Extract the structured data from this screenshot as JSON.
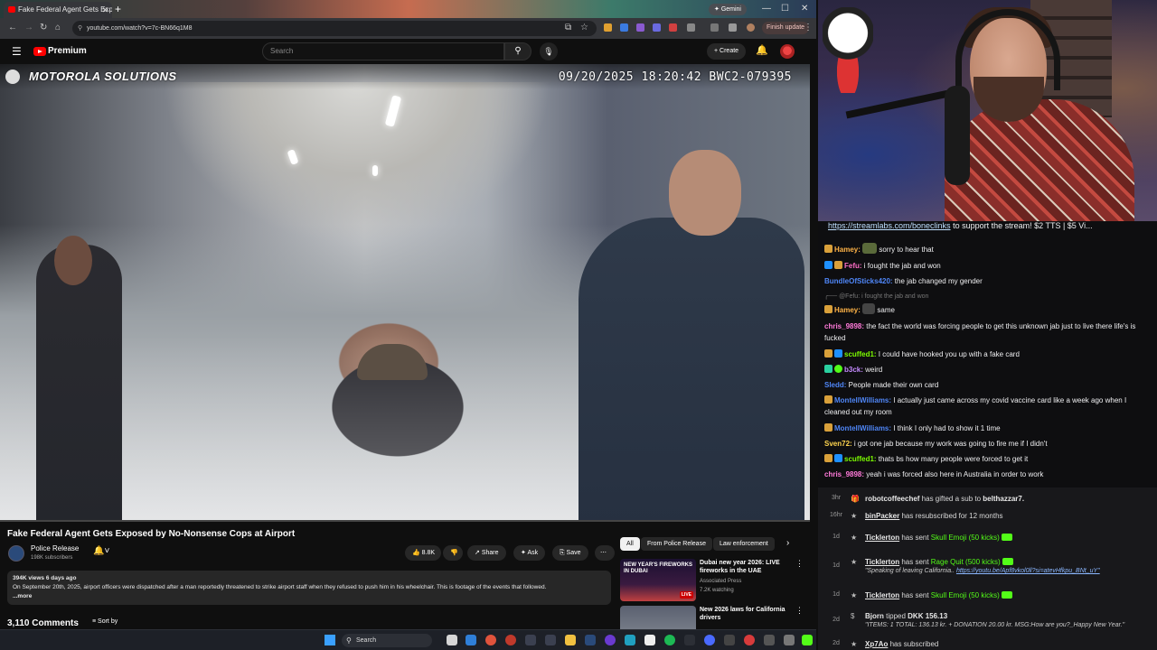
{
  "browser": {
    "tab_title": "Fake Federal Agent Gets Expos",
    "gemini_label": "Gemini",
    "url": "youtube.com/watch?v=7c-BN66q1M8",
    "finish_update_label": "Finish update"
  },
  "youtube": {
    "logo_text": "Premium",
    "search_placeholder": "Search",
    "create_label": "Create",
    "video": {
      "brand_text": "MOTOROLA SOLUTIONS",
      "timestamp": "09/20/2025 18:20:42 BWC2-079395",
      "progress": 0.0
    },
    "title": "Fake Federal Agent Gets Exposed by No-Nonsense Cops at Airport",
    "channel": {
      "name": "Police Release",
      "subs": "198K subscribers"
    },
    "actions": {
      "likes": "8.8K",
      "share": "Share",
      "ask": "Ask",
      "save": "Save"
    },
    "description": {
      "meta": "394K views  6 days ago",
      "text": "On September 20th, 2025, airport officers were dispatched after a man reportedly threatened to strike airport staff when they refused to push him in his wheelchair. This is footage of the events that followed.",
      "more": "...more"
    },
    "comments_count": "3,110 Comments",
    "sort_label": "Sort by",
    "chips": [
      "All",
      "From Police Release",
      "Law enforcement"
    ],
    "recommendations": [
      {
        "title": "Dubai new year 2026: LIVE fireworks in the UAE",
        "channel": "Associated Press",
        "views": "7.2K watching",
        "thumb_text": "NEW YEAR'S FIREWORKS IN DUBAI",
        "badge": "LIVE"
      },
      {
        "title": "New 2026 laws for California drivers",
        "channel": "",
        "views": "",
        "thumb_text": "",
        "badge": ""
      }
    ]
  },
  "taskbar": {
    "search_placeholder": "Search"
  },
  "chat": {
    "banner_link": "https://streamlabs.com/boneclinks",
    "banner_rest": " to support the stream! $2 TTS | $5 Vi...",
    "messages": [
      {
        "user": "Hamey:",
        "text": " sorry to hear that",
        "color": "#ffb347"
      },
      {
        "user": "Fefu:",
        "text": " i fought the jab and won",
        "color": "#ff6ec7"
      },
      {
        "user": "BundleOfSticks420:",
        "text": " the jab changed my gender",
        "color": "#4f86f7"
      },
      {
        "user": "",
        "text": "@Fefu: i fought the jab and won",
        "color": "#777777"
      },
      {
        "user": "Hamey:",
        "text": " same",
        "color": "#ffb347"
      },
      {
        "user": "chris_9898:",
        "text": " the fact the world was forcing people to get this unknown jab just to live there life's is fucked",
        "color": "#ff7ad9"
      },
      {
        "user": "scuffed1:",
        "text": " I could have hooked you up with a fake card",
        "color": "#7cfc00"
      },
      {
        "user": "b3ck:",
        "text": " weird",
        "color": "#c58bff"
      },
      {
        "user": "Sledd:",
        "text": " People made their own card",
        "color": "#4f86f7"
      },
      {
        "user": "MontellWilliams:",
        "text": " I actually just came across my covid vaccine card like a week ago when I cleaned out my room",
        "color": "#4f86f7"
      },
      {
        "user": "MontellWilliams:",
        "text": " I think I only had to show it 1 time",
        "color": "#4f86f7"
      },
      {
        "user": "Sven72:",
        "text": " i got one jab because my work was going to fire me if I didn't",
        "color": "#ffd54f"
      },
      {
        "user": "scuffed1:",
        "text": " thats bs how many people were forced to get it",
        "color": "#7cfc00"
      },
      {
        "user": "chris_9898:",
        "text": " yeah i was forced also here in Australia in order to work",
        "color": "#ff7ad9"
      }
    ]
  },
  "events": [
    {
      "time": "3hr",
      "name": "robotcoffeechef",
      "text": " has gifted a sub to ",
      "target": "belthazzar7.",
      "extra": ""
    },
    {
      "time": "16hr",
      "name": "binPacker",
      "text": " has resubscribed for 12 months",
      "target": "",
      "extra": ""
    },
    {
      "time": "1d",
      "name": "Ticklerton",
      "text": " has sent ",
      "target": "Skull Emoji (50 kicks)",
      "extra": ""
    },
    {
      "time": "1d",
      "name": "Ticklerton",
      "text": " has sent ",
      "target": "Rage Quit (500 kicks)",
      "extra": "\"Speaking of leaving California..",
      "link": "https://youtu.be/Apf8vkol0ll?si=atevHfkpu_BNt_uY\""
    },
    {
      "time": "1d",
      "name": "Ticklerton",
      "text": " has sent ",
      "target": "Skull Emoji (50 kicks)",
      "extra": ""
    },
    {
      "time": "2d",
      "name": "Bjorn",
      "text": " tipped ",
      "target": "DKK 156.13",
      "extra": "\"ITEMS: 1 TOTAL: 136.13 kr. + DONATION 20.00 kr. MSG:How are you?_Happy New Year.\""
    },
    {
      "time": "2d",
      "name": "Xp7Ao",
      "text": " has subscribed",
      "target": "",
      "extra": ""
    }
  ],
  "colors": {
    "yt_red": "#ff0000",
    "kick_green": "#53fc18",
    "link_blue": "#3ea6ff"
  }
}
